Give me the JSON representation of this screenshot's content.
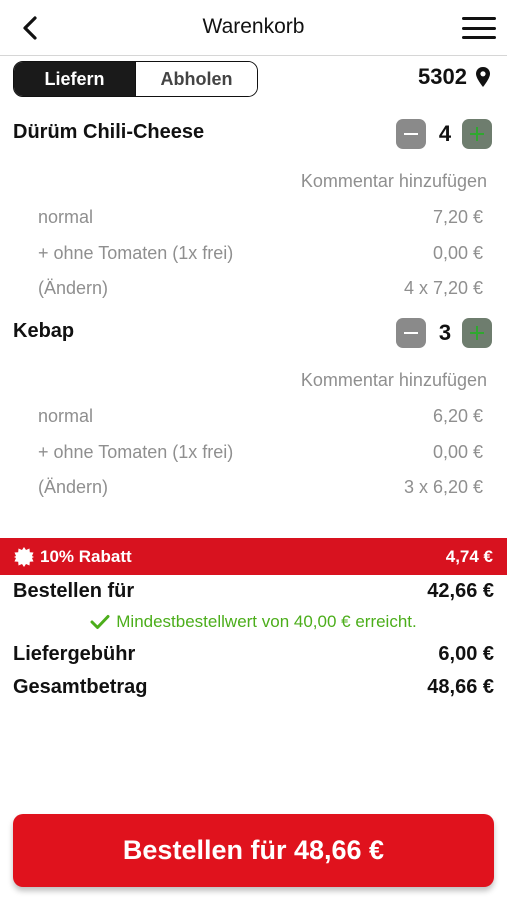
{
  "header": {
    "title": "Warenkorb",
    "back_icon": "chevron-left-icon",
    "menu_icon": "hamburger-menu-icon"
  },
  "mode": {
    "options": [
      "Liefern",
      "Abholen"
    ],
    "selected": "Liefern"
  },
  "location": {
    "postcode": "5302",
    "icon": "map-pin-icon"
  },
  "items": [
    {
      "name": "Dürüm Chili-Cheese",
      "quantity": "4",
      "comment_label": "Kommentar hinzufügen",
      "lines": [
        {
          "label": "normal",
          "price": "7,20 €"
        },
        {
          "label": "+ ohne Tomaten (1x frei)",
          "price": "0,00 €"
        },
        {
          "label": "(Ändern)",
          "price": "4 x 7,20 €"
        }
      ]
    },
    {
      "name": "Kebap",
      "quantity": "3",
      "comment_label": "Kommentar hinzufügen",
      "lines": [
        {
          "label": "normal",
          "price": "6,20 €"
        },
        {
          "label": "+ ohne Tomaten (1x frei)",
          "price": "0,00 €"
        },
        {
          "label": "(Ändern)",
          "price": "3 x 6,20 €"
        }
      ]
    }
  ],
  "discount": {
    "label": "10% Rabatt",
    "amount": "4,74 €",
    "icon": "discount-badge-icon"
  },
  "summary": {
    "order_for_label": "Bestellen für",
    "order_for_value": "42,66 €",
    "min_order_note": "Mindestbestellwert von 40,00 € erreicht.",
    "delivery_fee_label": "Liefergebühr",
    "delivery_fee_value": "6,00 €",
    "total_label": "Gesamtbetrag",
    "total_value": "48,66 €"
  },
  "order_button": {
    "label": "Bestellen für 48,66 €"
  },
  "colors": {
    "accent_red": "#e0121d",
    "discount_red": "#d8121f",
    "success_green": "#4cae1b",
    "muted_text": "#8f8f8f"
  }
}
